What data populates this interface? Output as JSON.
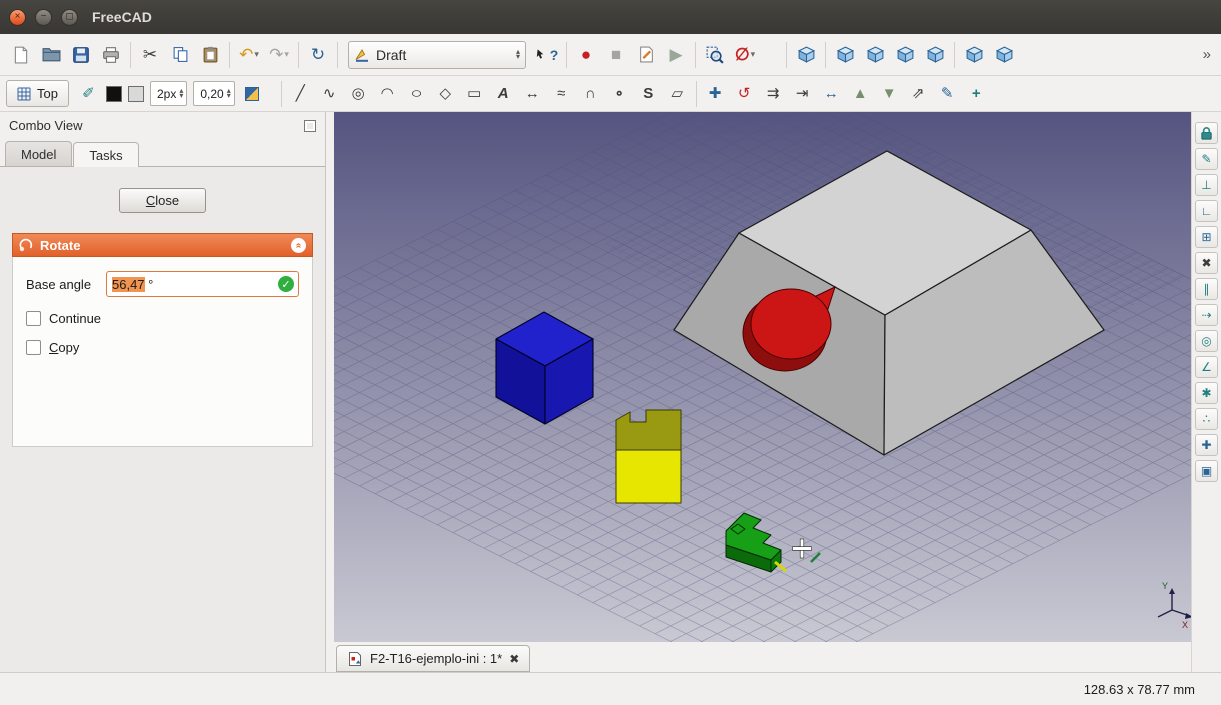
{
  "window": {
    "title": "FreeCAD"
  },
  "titlebar_icons": {
    "close": "×",
    "minimize": "−",
    "maximize": "◻"
  },
  "toolbar1": {
    "workbench_selected": "Draft",
    "overflow": "»",
    "glyphs": {
      "cut": "✂",
      "undo": "↶",
      "redo": "↷",
      "caret": "▾",
      "up": "▴",
      "down": "▾",
      "refresh": "↻",
      "record": "●",
      "stop": "■",
      "play": "▶",
      "clip": "∅",
      "question": "?"
    }
  },
  "toolbar2": {
    "plane_label": "Top",
    "line_width_value": "2px",
    "text_scale_value": "0,20",
    "construction": "✐",
    "tools": {
      "line": "╱",
      "polyline": "∿",
      "circle": "◎",
      "arc": "◠",
      "ellipse": "○",
      "polygon": "◇",
      "rectangle": "▭",
      "text": "A",
      "dimension": "↔",
      "bspline": "≈",
      "bezier": "∩",
      "point": "∘",
      "shapestring": "S",
      "facebinder": "▱"
    },
    "mods": {
      "move": "✚",
      "rotate": "↺",
      "offset": "⇉",
      "trim": "⇥",
      "stretch": "↔",
      "upgrade": "▲",
      "downgrade": "▼",
      "scale": "⇗",
      "edit": "✎",
      "addpoint": "+"
    }
  },
  "snapbar": {
    "endpoint": "✎",
    "midpoint": "⊥",
    "perpendicular": "∟",
    "grid": "⊞",
    "intersection": "✖",
    "parallel": "∥",
    "extension": "⇢",
    "center": "◎",
    "angle": "∠",
    "special": "✱",
    "near": "∴",
    "ortho": "✚",
    "working_plane": "▣"
  },
  "combo_view": {
    "title": "Combo View",
    "tab_model": "Model",
    "tab_tasks": "Tasks",
    "close_button": "Close",
    "task": {
      "title": "Rotate",
      "collapse": "«",
      "base_angle_label": "Base angle",
      "angle_value": "56,47",
      "angle_unit": " °",
      "check": "✓",
      "continue_label": "Continue",
      "copy_label": "Copy"
    }
  },
  "document_tab": {
    "label": "F2-T16-ejemplo-ini : 1*",
    "close": "✖"
  },
  "viewport": {
    "axis_x": "X",
    "axis_y": "Y"
  },
  "status_bar": {
    "dimensions": "128.63 x 78.77 mm"
  },
  "colors": {
    "accent_orange": "#e2602a",
    "selection_orange": "#f0944f",
    "check_green": "#2eaf3f",
    "viewport_top": "#555480",
    "viewport_bottom": "#c9c9d3"
  }
}
